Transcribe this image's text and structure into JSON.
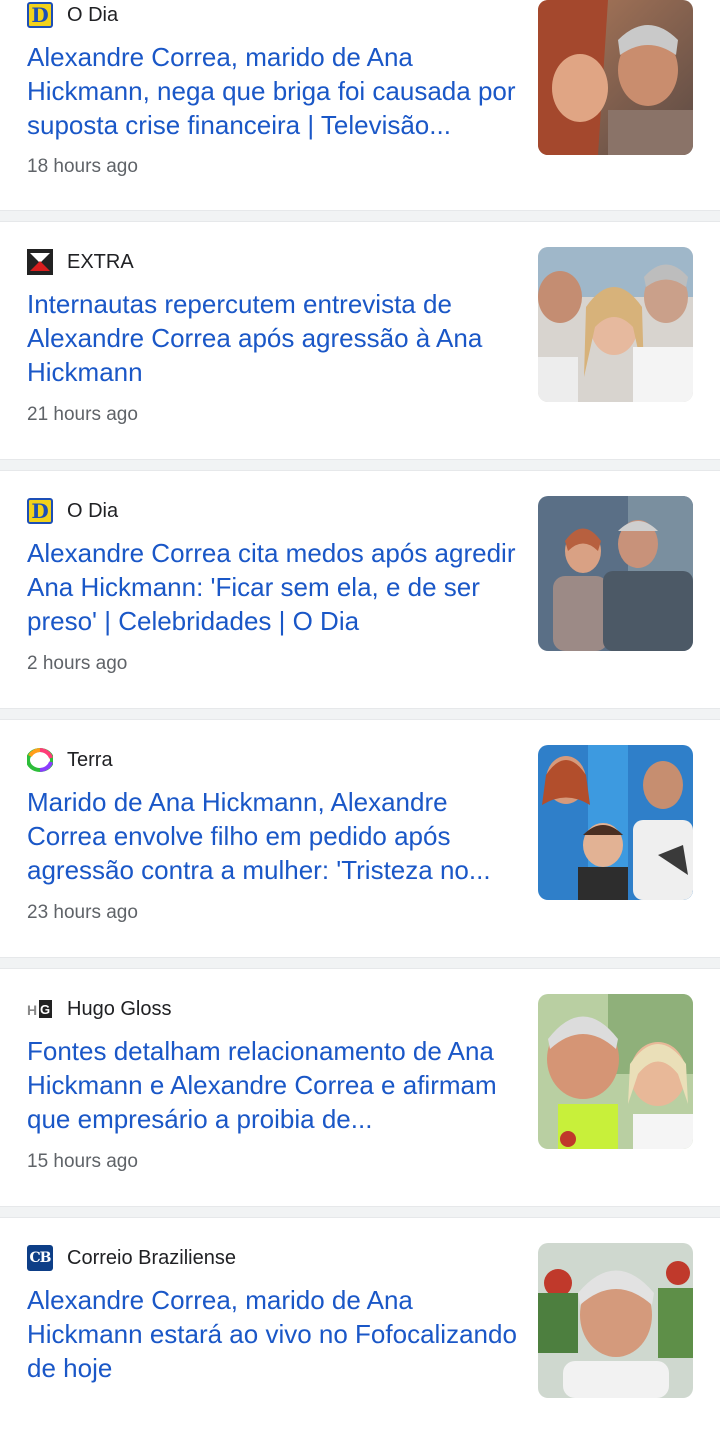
{
  "articles": [
    {
      "source": "O Dia",
      "title": "Alexandre Correa, marido de Ana Hickmann, nega que briga foi causada por suposta crise financeira | Televisão...",
      "time": "18 hours ago",
      "logo": "odia-logo-icon"
    },
    {
      "source": "EXTRA",
      "title": "Internautas repercutem entrevista de Alexandre Correa após agressão à Ana Hickmann",
      "time": "21 hours ago",
      "logo": "extra-logo-icon"
    },
    {
      "source": "O Dia",
      "title": "Alexandre Correa cita medos após agredir Ana Hickmann: 'Ficar sem ela, e de ser preso' | Celebridades | O Dia",
      "time": "2 hours ago",
      "logo": "odia-logo-icon"
    },
    {
      "source": "Terra",
      "title": "Marido de Ana Hickmann, Alexandre Correa envolve filho em pedido após agressão contra a mulher: 'Tristeza no...",
      "time": "23 hours ago",
      "logo": "terra-logo-icon"
    },
    {
      "source": "Hugo Gloss",
      "title": "Fontes detalham relacionamento de Ana Hickmann e Alexandre Correa e afirmam que empresário a proibia de...",
      "time": "15 hours ago",
      "logo": "hugo-gloss-logo-icon"
    },
    {
      "source": "Correio Braziliense",
      "title": "Alexandre Correa, marido de Ana Hickmann estará ao vivo no Fofocalizando de hoje",
      "time": "",
      "logo": "correio-logo-icon"
    }
  ],
  "logo_text": {
    "odia": "D",
    "hugo": "HG",
    "cb": "CB"
  },
  "colors": {
    "headline": "#1a57c7",
    "source": "#202124",
    "time": "#5f6368",
    "separator": "#f1f3f4"
  }
}
